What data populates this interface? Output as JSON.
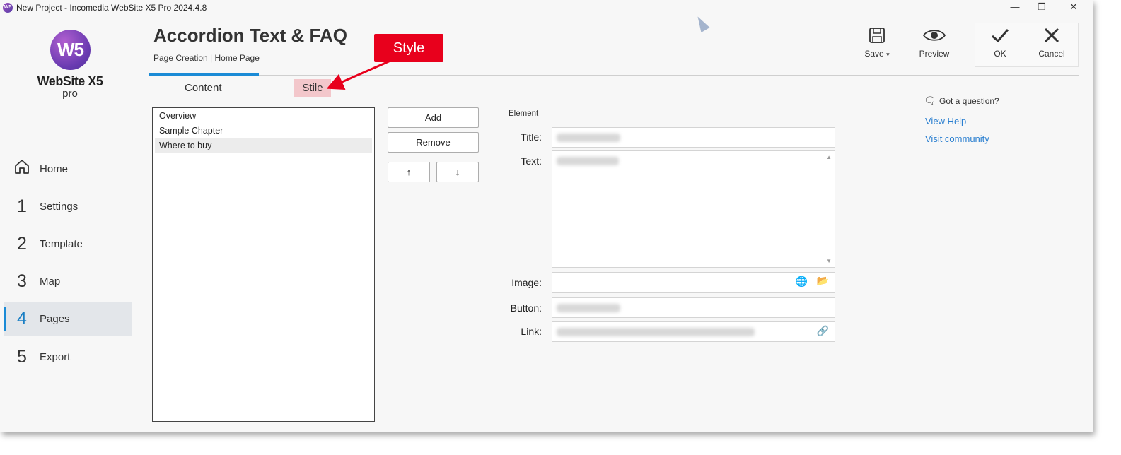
{
  "window": {
    "title": "New Project - Incomedia WebSite X5 Pro 2024.4.8",
    "minimize": "—",
    "restore": "❐",
    "close": "✕"
  },
  "brand": {
    "logo_mark": "W5",
    "name": "WebSite X5",
    "edition": "pro"
  },
  "nav": {
    "items": [
      {
        "num": "",
        "label": "Home",
        "icon": "home-icon"
      },
      {
        "num": "1",
        "label": "Settings"
      },
      {
        "num": "2",
        "label": "Template"
      },
      {
        "num": "3",
        "label": "Map"
      },
      {
        "num": "4",
        "label": "Pages",
        "active": true
      },
      {
        "num": "5",
        "label": "Export"
      }
    ]
  },
  "header": {
    "title": "Accordion Text & FAQ",
    "breadcrumb": "Page Creation | Home Page"
  },
  "tabs": [
    {
      "label": "Content",
      "active": true
    },
    {
      "label": "Stile"
    }
  ],
  "annotation": {
    "callout": "Style",
    "color": "#e8001c"
  },
  "toolbar": {
    "save": "Save",
    "preview": "Preview",
    "ok": "OK",
    "cancel": "Cancel"
  },
  "list": {
    "items": [
      "Overview",
      "Sample Chapter",
      "Where to buy"
    ],
    "selected_index": 2
  },
  "list_buttons": {
    "add": "Add",
    "remove": "Remove",
    "up": "↑",
    "down": "↓"
  },
  "form": {
    "group": "Element",
    "title_label": "Title:",
    "text_label": "Text:",
    "image_label": "Image:",
    "button_label": "Button:",
    "link_label": "Link:"
  },
  "help": {
    "title": "Got a question?",
    "view_help": "View Help",
    "visit_community": "Visit community"
  },
  "colors": {
    "accent": "#1b8bd6",
    "tab_highlight": "#f3c7cb",
    "link": "#2a7fd0"
  }
}
